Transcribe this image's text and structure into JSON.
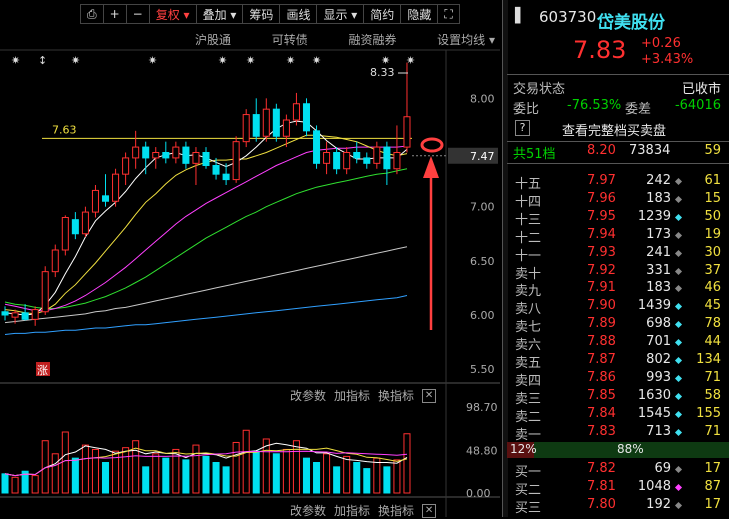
{
  "toolbar": {
    "items": [
      "⎙",
      "+",
      "−",
      "复权 ▾",
      "叠加 ▾",
      "筹码",
      "画线",
      "显示 ▾",
      "简约",
      "隐藏",
      "⛶"
    ]
  },
  "subbar": {
    "items": [
      "沪股通",
      "可转债",
      "融资融券",
      "设置均线 ▾"
    ]
  },
  "chart": {
    "price_ticks": [
      "8.00",
      "7.50",
      "7.00",
      "6.50",
      "6.00",
      "5.50"
    ],
    "current_price_tag": "7.47",
    "high_label": "8.33",
    "ref_line_label": "7.63",
    "limit_up_tag": "涨",
    "vol_ticks": [
      "98.70",
      "48.80",
      "0.00"
    ],
    "colors": {
      "up": "#ff3030",
      "down": "#00e0f0",
      "ma5": "#ffffff",
      "ma10": "#f0e040",
      "ma20": "#ff40ff",
      "ma30": "#30e030",
      "ma60": "#c8c8c8",
      "ma120": "#30a0ff"
    }
  },
  "indicator_bar": {
    "items": [
      "改参数",
      "加指标",
      "换指标"
    ],
    "close": "✕"
  },
  "chart_data": {
    "type": "candlestick",
    "ylim": [
      5.4,
      8.4
    ],
    "candles": [
      {
        "o": 6.03,
        "h": 6.08,
        "l": 5.95,
        "c": 6.0
      },
      {
        "o": 5.98,
        "h": 6.05,
        "l": 5.92,
        "c": 6.02
      },
      {
        "o": 6.02,
        "h": 6.1,
        "l": 5.95,
        "c": 5.96
      },
      {
        "o": 5.96,
        "h": 6.08,
        "l": 5.9,
        "c": 6.05
      },
      {
        "o": 6.03,
        "h": 6.45,
        "l": 6.0,
        "c": 6.4
      },
      {
        "o": 6.4,
        "h": 6.65,
        "l": 6.35,
        "c": 6.6
      },
      {
        "o": 6.6,
        "h": 6.92,
        "l": 6.55,
        "c": 6.9
      },
      {
        "o": 6.88,
        "h": 6.95,
        "l": 6.7,
        "c": 6.75
      },
      {
        "o": 6.75,
        "h": 7.0,
        "l": 6.72,
        "c": 6.95
      },
      {
        "o": 6.95,
        "h": 7.2,
        "l": 6.9,
        "c": 7.15
      },
      {
        "o": 7.1,
        "h": 7.3,
        "l": 7.0,
        "c": 7.05
      },
      {
        "o": 7.05,
        "h": 7.35,
        "l": 7.0,
        "c": 7.3
      },
      {
        "o": 7.3,
        "h": 7.5,
        "l": 7.2,
        "c": 7.45
      },
      {
        "o": 7.45,
        "h": 7.7,
        "l": 7.35,
        "c": 7.55
      },
      {
        "o": 7.55,
        "h": 7.6,
        "l": 7.3,
        "c": 7.45
      },
      {
        "o": 7.45,
        "h": 7.55,
        "l": 7.35,
        "c": 7.5
      },
      {
        "o": 7.5,
        "h": 7.6,
        "l": 7.4,
        "c": 7.45
      },
      {
        "o": 7.45,
        "h": 7.6,
        "l": 7.4,
        "c": 7.55
      },
      {
        "o": 7.55,
        "h": 7.6,
        "l": 7.35,
        "c": 7.4
      },
      {
        "o": 7.4,
        "h": 7.55,
        "l": 7.2,
        "c": 7.5
      },
      {
        "o": 7.5,
        "h": 7.55,
        "l": 7.35,
        "c": 7.38
      },
      {
        "o": 7.38,
        "h": 7.45,
        "l": 7.25,
        "c": 7.3
      },
      {
        "o": 7.3,
        "h": 7.4,
        "l": 7.2,
        "c": 7.25
      },
      {
        "o": 7.25,
        "h": 7.65,
        "l": 7.22,
        "c": 7.6
      },
      {
        "o": 7.6,
        "h": 7.9,
        "l": 7.55,
        "c": 7.85
      },
      {
        "o": 7.85,
        "h": 8.0,
        "l": 7.6,
        "c": 7.65
      },
      {
        "o": 7.65,
        "h": 8.0,
        "l": 7.6,
        "c": 7.9
      },
      {
        "o": 7.9,
        "h": 7.95,
        "l": 7.6,
        "c": 7.65
      },
      {
        "o": 7.65,
        "h": 7.85,
        "l": 7.55,
        "c": 7.8
      },
      {
        "o": 7.8,
        "h": 8.05,
        "l": 7.75,
        "c": 7.95
      },
      {
        "o": 7.95,
        "h": 8.0,
        "l": 7.65,
        "c": 7.7
      },
      {
        "o": 7.7,
        "h": 7.75,
        "l": 7.35,
        "c": 7.4
      },
      {
        "o": 7.4,
        "h": 7.6,
        "l": 7.3,
        "c": 7.5
      },
      {
        "o": 7.5,
        "h": 7.55,
        "l": 7.3,
        "c": 7.35
      },
      {
        "o": 7.35,
        "h": 7.55,
        "l": 7.3,
        "c": 7.5
      },
      {
        "o": 7.5,
        "h": 7.6,
        "l": 7.4,
        "c": 7.45
      },
      {
        "o": 7.45,
        "h": 7.5,
        "l": 7.35,
        "c": 7.4
      },
      {
        "o": 7.4,
        "h": 7.6,
        "l": 7.35,
        "c": 7.55
      },
      {
        "o": 7.55,
        "h": 7.6,
        "l": 7.2,
        "c": 7.35
      },
      {
        "o": 7.35,
        "h": 7.75,
        "l": 7.3,
        "c": 7.5
      },
      {
        "o": 7.55,
        "h": 8.33,
        "l": 7.5,
        "c": 7.83
      }
    ],
    "ma5": [
      6.02,
      6.01,
      6.0,
      6.01,
      6.09,
      6.21,
      6.38,
      6.54,
      6.72,
      6.87,
      6.96,
      7.04,
      7.14,
      7.26,
      7.36,
      7.45,
      7.48,
      7.5,
      7.47,
      7.48,
      7.45,
      7.41,
      7.37,
      7.41,
      7.47,
      7.55,
      7.64,
      7.72,
      7.77,
      7.79,
      7.78,
      7.7,
      7.61,
      7.54,
      7.49,
      7.44,
      7.44,
      7.45,
      7.45,
      7.45,
      7.53
    ],
    "ma10": [
      6.05,
      6.04,
      6.02,
      6.01,
      6.04,
      6.1,
      6.2,
      6.28,
      6.38,
      6.48,
      6.59,
      6.7,
      6.81,
      6.93,
      7.04,
      7.12,
      7.21,
      7.29,
      7.34,
      7.38,
      7.41,
      7.43,
      7.43,
      7.44,
      7.44,
      7.47,
      7.5,
      7.54,
      7.58,
      7.62,
      7.66,
      7.66,
      7.65,
      7.64,
      7.62,
      7.6,
      7.56,
      7.52,
      7.49,
      7.47,
      7.49
    ],
    "ma20": [
      6.1,
      6.08,
      6.06,
      6.04,
      6.04,
      6.06,
      6.09,
      6.13,
      6.18,
      6.24,
      6.3,
      6.37,
      6.44,
      6.52,
      6.6,
      6.68,
      6.76,
      6.84,
      6.91,
      6.97,
      7.03,
      7.08,
      7.13,
      7.18,
      7.23,
      7.28,
      7.33,
      7.38,
      7.42,
      7.46,
      7.5,
      7.52,
      7.53,
      7.54,
      7.54,
      7.55,
      7.55,
      7.55,
      7.55,
      7.55,
      7.56
    ],
    "ma30": [
      6.12,
      6.1,
      6.09,
      6.07,
      6.06,
      6.06,
      6.07,
      6.09,
      6.11,
      6.14,
      6.17,
      6.21,
      6.25,
      6.3,
      6.35,
      6.41,
      6.47,
      6.53,
      6.59,
      6.65,
      6.71,
      6.76,
      6.81,
      6.86,
      6.91,
      6.95,
      7.0,
      7.04,
      7.08,
      7.12,
      7.15,
      7.18,
      7.2,
      7.22,
      7.24,
      7.26,
      7.28,
      7.3,
      7.31,
      7.33,
      7.35
    ],
    "ma60": [
      5.93,
      5.94,
      5.95,
      5.96,
      5.97,
      5.98,
      5.99,
      6.0,
      6.01,
      6.03,
      6.04,
      6.06,
      6.07,
      6.09,
      6.11,
      6.13,
      6.15,
      6.17,
      6.19,
      6.21,
      6.23,
      6.25,
      6.27,
      6.29,
      6.31,
      6.33,
      6.35,
      6.37,
      6.39,
      6.41,
      6.43,
      6.45,
      6.47,
      6.49,
      6.51,
      6.53,
      6.55,
      6.57,
      6.59,
      6.61,
      6.63
    ],
    "ma120": [
      5.82,
      5.83,
      5.83,
      5.84,
      5.84,
      5.85,
      5.86,
      5.86,
      5.87,
      5.88,
      5.88,
      5.89,
      5.9,
      5.91,
      5.91,
      5.92,
      5.93,
      5.94,
      5.95,
      5.96,
      5.97,
      5.98,
      5.99,
      6.0,
      6.01,
      6.02,
      6.03,
      6.04,
      6.05,
      6.06,
      6.07,
      6.08,
      6.09,
      6.1,
      6.11,
      6.12,
      6.13,
      6.14,
      6.15,
      6.16,
      6.18
    ],
    "volume": [
      22,
      18,
      25,
      20,
      60,
      45,
      70,
      40,
      55,
      50,
      35,
      48,
      52,
      60,
      30,
      45,
      40,
      50,
      38,
      55,
      42,
      35,
      30,
      58,
      72,
      48,
      62,
      45,
      50,
      60,
      40,
      35,
      45,
      30,
      42,
      35,
      28,
      40,
      30,
      38,
      68
    ],
    "vol_ylim": [
      0,
      98.7
    ]
  },
  "quote": {
    "code": "603730",
    "name": "岱美股份",
    "price": "7.83",
    "change": "+0.26",
    "change_pct": "+3.43%",
    "status_label": "交易状态",
    "status_value": "已收市",
    "weibi_label": "委比",
    "weibi_value": "-76.53%",
    "weicha_label": "委差",
    "weicha_value": "-64016",
    "full_book": "查看完整档买卖盘",
    "total_label": "共51档",
    "total_price": "8.20",
    "total_vol": "73834",
    "total_count": "59",
    "asks": [
      {
        "label": "十五",
        "price": "7.97",
        "vol": "242",
        "count": "61",
        "mark": "gray"
      },
      {
        "label": "十四",
        "price": "7.96",
        "vol": "183",
        "count": "15",
        "mark": "gray"
      },
      {
        "label": "十三",
        "price": "7.95",
        "vol": "1239",
        "count": "50",
        "mark": "cyan"
      },
      {
        "label": "十二",
        "price": "7.94",
        "vol": "173",
        "count": "19",
        "mark": "gray"
      },
      {
        "label": "十一",
        "price": "7.93",
        "vol": "241",
        "count": "30",
        "mark": "gray"
      },
      {
        "label": "卖十",
        "price": "7.92",
        "vol": "331",
        "count": "37",
        "mark": "gray"
      },
      {
        "label": "卖九",
        "price": "7.91",
        "vol": "183",
        "count": "46",
        "mark": "gray"
      },
      {
        "label": "卖八",
        "price": "7.90",
        "vol": "1439",
        "count": "45",
        "mark": "cyan"
      },
      {
        "label": "卖七",
        "price": "7.89",
        "vol": "698",
        "count": "78",
        "mark": "cyan"
      },
      {
        "label": "卖六",
        "price": "7.88",
        "vol": "701",
        "count": "44",
        "mark": "cyan"
      },
      {
        "label": "卖五",
        "price": "7.87",
        "vol": "802",
        "count": "134",
        "mark": "cyan"
      },
      {
        "label": "卖四",
        "price": "7.86",
        "vol": "993",
        "count": "71",
        "mark": "cyan"
      },
      {
        "label": "卖三",
        "price": "7.85",
        "vol": "1630",
        "count": "58",
        "mark": "cyan"
      },
      {
        "label": "卖二",
        "price": "7.84",
        "vol": "1545",
        "count": "155",
        "mark": "cyan"
      },
      {
        "label": "卖一",
        "price": "7.83",
        "vol": "713",
        "count": "71",
        "mark": "cyan"
      }
    ],
    "ratio_left": "12%",
    "ratio_right": "88%",
    "bids": [
      {
        "label": "买一",
        "price": "7.82",
        "vol": "69",
        "count": "17",
        "mark": "gray"
      },
      {
        "label": "买二",
        "price": "7.81",
        "vol": "1048",
        "count": "87",
        "mark": "magenta"
      },
      {
        "label": "买三",
        "price": "7.80",
        "vol": "192",
        "count": "17",
        "mark": "gray"
      }
    ]
  }
}
